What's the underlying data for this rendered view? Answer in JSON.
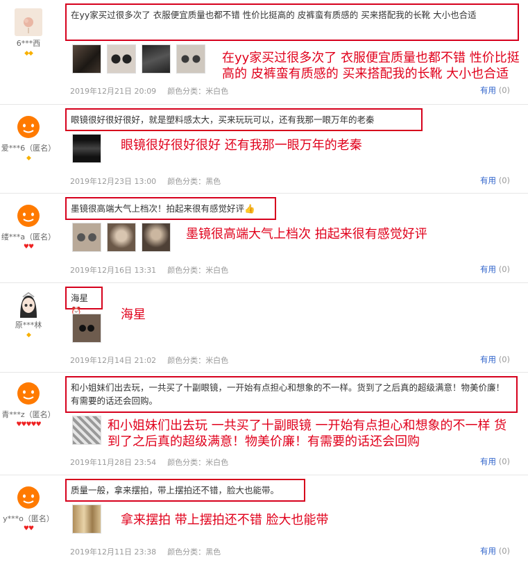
{
  "reviews": [
    {
      "username": "6***西",
      "level": "◆◆",
      "level_color": "#f8b000",
      "comment": "在yy家买过很多次了 衣服便宜质量也都不错 性价比挺高的 皮裤蛮有质感的 买来搭配我的长靴 大小也合适",
      "annotation": "在yy家买过很多次了 衣服便宜质量也都不错 性价比挺高的 皮裤蛮有质感的 买来搭配我的长靴 大小也合适",
      "timestamp": "2019年12月21日 20:09",
      "color_label": "颜色分类：",
      "color_value": "米白色",
      "useful_label": "有用",
      "useful_count": "(0)"
    },
    {
      "username": "爱***6（匿名）",
      "level": "◆",
      "level_color": "#f8b000",
      "comment": "眼镜很好很好很好，就是塑料感太大，买来玩玩可以，还有我那一眼万年的老秦",
      "annotation": "眼镜很好很好很好 还有我那一眼万年的老秦",
      "timestamp": "2019年12月23日 13:00",
      "color_label": "颜色分类：",
      "color_value": "黑色",
      "useful_label": "有用",
      "useful_count": "(0)"
    },
    {
      "username": "缕***a（匿名）",
      "level": "♥♥",
      "level_color": "#e22222",
      "comment": "墨镜很高端大气上档次！拍起来很有感觉好评👍",
      "annotation": "墨镜很高端大气上档次 拍起来很有感觉好评",
      "timestamp": "2019年12月16日 13:31",
      "color_label": "颜色分类：",
      "color_value": "米白色",
      "useful_label": "有用",
      "useful_count": "(0)"
    },
    {
      "username": "原***林",
      "level": "◆",
      "level_color": "#f8b000",
      "comment": "海星⏰",
      "annotation": "海星",
      "timestamp": "2019年12月14日 21:02",
      "color_label": "颜色分类：",
      "color_value": "米白色",
      "useful_label": "有用",
      "useful_count": "(0)"
    },
    {
      "username": "青***z（匿名）",
      "level": "♥♥♥♥♥",
      "level_color": "#e22222",
      "comment": "和小姐妹们出去玩，一共买了十副眼镜，一开始有点担心和想象的不一样。货到了之后真的超级满意！物美价廉！有需要的话还会回购。",
      "annotation": "和小姐妹们出去玩 一共买了十副眼镜 一开始有点担心和想象的不一样 货到了之后真的超级满意！物美价廉！有需要的话还会回购",
      "timestamp": "2019年11月28日 23:54",
      "color_label": "颜色分类：",
      "color_value": "米白色",
      "useful_label": "有用",
      "useful_count": "(0)"
    },
    {
      "username": "y***o（匿名）",
      "level": "♥♥",
      "level_color": "#e22222",
      "comment": "质量一般，拿来摆拍，带上摆拍还不错，脸大也能带。",
      "annotation": "拿来摆拍 带上摆拍还不错 脸大也能带",
      "timestamp": "2019年12月11日 23:38",
      "color_label": "颜色分类：",
      "color_value": "黑色",
      "useful_label": "有用",
      "useful_count": "(0)"
    }
  ]
}
